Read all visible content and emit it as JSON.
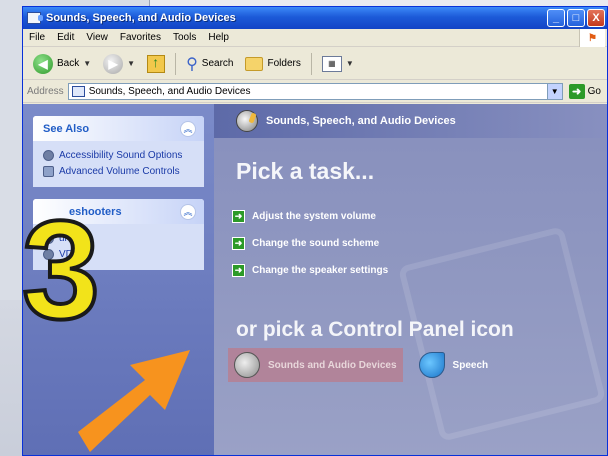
{
  "window": {
    "title": "Sounds, Speech, and Audio Devices",
    "controls": {
      "minimize": "_",
      "maximize": "□",
      "close": "X"
    }
  },
  "menu": [
    "File",
    "Edit",
    "View",
    "Favorites",
    "Tools",
    "Help"
  ],
  "toolbar": {
    "back_label": "Back",
    "search_label": "Search",
    "folders_label": "Folders"
  },
  "address": {
    "label": "Address",
    "value": "Sounds, Speech, and Audio Devices",
    "go_label": "Go"
  },
  "see_also": {
    "title": "See Also",
    "items": [
      "Accessibility Sound Options",
      "Advanced Volume Controls"
    ]
  },
  "troubleshooters": {
    "title": "Troubleshooters",
    "title_visible": "eshooters",
    "items": [
      "Sound",
      "DVD"
    ],
    "items_visible": [
      "und",
      "VD"
    ]
  },
  "main": {
    "header": "Sounds, Speech, and Audio Devices",
    "pick_task": "Pick a task...",
    "tasks": [
      "Adjust the system volume",
      "Change the sound scheme",
      "Change the speaker settings"
    ],
    "pick_icon": "or pick a Control Panel icon",
    "icons": [
      "Sounds and Audio Devices",
      "Speech"
    ]
  },
  "annotation": {
    "step_number": "3",
    "number_color": "#f2e31a",
    "arrow_color": "#f7931e"
  }
}
